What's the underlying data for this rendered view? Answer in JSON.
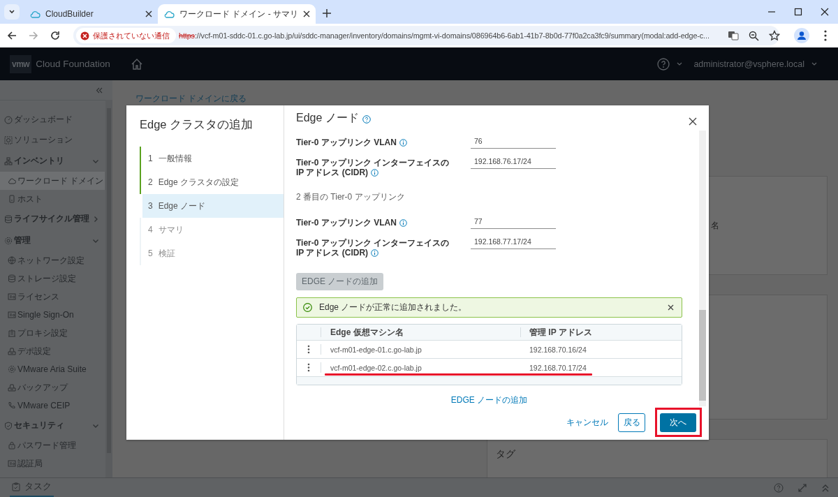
{
  "browser": {
    "tabs": [
      {
        "title": "CloudBuilder",
        "selected": false
      },
      {
        "title": "ワークロード ドメイン - サマリ",
        "selected": true
      }
    ],
    "security_chip": "保護されていない通信",
    "url_scheme": "https",
    "url_rest": "://vcf-m01-sddc-01.c.go-lab.jp/ui/sddc-manager/inventory/domains/mgmt-vi-domains/086964b6-6ab1-41b7-8b0d-77f0a2ca3fc9/summary(modal:add-edge-c..."
  },
  "header": {
    "logo": "vmw",
    "product": "Cloud Foundation",
    "user": "administrator@vsphere.local"
  },
  "sidebar": {
    "items": [
      {
        "label": "ダッシュボード",
        "selected": false
      },
      {
        "label": "ソリューション",
        "selected": false
      },
      {
        "label": "インベントリ",
        "expanded": true,
        "selected": false,
        "children": [
          {
            "label": "ワークロード ドメイン",
            "selected": true
          },
          {
            "label": "ホスト",
            "selected": false
          }
        ]
      },
      {
        "label": "ライフサイクル管理",
        "expanded": false,
        "selected": false
      },
      {
        "label": "管理",
        "expanded": true,
        "selected": false,
        "children": [
          {
            "label": "ネットワーク設定",
            "selected": false
          },
          {
            "label": "ストレージ設定",
            "selected": false
          },
          {
            "label": "ライセンス",
            "selected": false
          },
          {
            "label": "Single Sign-On",
            "selected": false
          },
          {
            "label": "プロキシ設定",
            "selected": false
          },
          {
            "label": "デポ設定",
            "selected": false
          },
          {
            "label": "VMware Aria Suite",
            "selected": false
          },
          {
            "label": "バックアップ",
            "selected": false
          },
          {
            "label": "VMware CEIP",
            "selected": false
          }
        ]
      },
      {
        "label": "セキュリティ",
        "expanded": true,
        "selected": false,
        "children": [
          {
            "label": "パスワード管理",
            "selected": false
          },
          {
            "label": "認証局",
            "selected": false
          }
        ]
      }
    ]
  },
  "main": {
    "breadcrumb": "ワークロード ドメインに戻る",
    "card_fragment": "名",
    "tag_card_title": "タグ"
  },
  "modal": {
    "title": "Edge クラスタの追加",
    "steps": [
      {
        "number": "1",
        "label": "一般情報",
        "completed": true,
        "selected": false
      },
      {
        "number": "2",
        "label": "Edge クラスタの設定",
        "completed": true,
        "selected": false
      },
      {
        "number": "3",
        "label": "Edge ノード",
        "completed": false,
        "selected": true
      },
      {
        "number": "4",
        "label": "サマリ",
        "completed": false,
        "selected": false
      },
      {
        "number": "5",
        "label": "検証",
        "completed": false,
        "selected": false
      }
    ],
    "page_title": "Edge ノード",
    "fields_first": [
      {
        "label_lines": [
          "Tier-0 アップリンク VLAN"
        ],
        "value": "76"
      },
      {
        "label_lines": [
          "Tier-0 アップリンク インターフェイスの",
          "IP アドレス (CIDR)"
        ],
        "value": "192.168.76.17/24"
      }
    ],
    "section_title": "2 番目の Tier-0 アップリンク",
    "fields_second": [
      {
        "label_lines": [
          "Tier-0 アップリンク VLAN"
        ],
        "value": "77"
      },
      {
        "label_lines": [
          "Tier-0 アップリンク インターフェイスの",
          "IP アドレス (CIDR)"
        ],
        "value": "192.168.77.17/24"
      }
    ],
    "add_button": {
      "label": "EDGE ノードの追加",
      "disabled": true
    },
    "alert": {
      "message": "Edge ノードが正常に追加されました。"
    },
    "table": {
      "columns": [
        "Edge 仮想マシン名",
        "管理 IP アドレス"
      ],
      "rows": [
        {
          "name": "vcf-m01-edge-01.c.go-lab.jp",
          "ip": "192.168.70.16/24",
          "highlighted": false
        },
        {
          "name": "vcf-m01-edge-02.c.go-lab.jp",
          "ip": "192.168.70.17/24",
          "highlighted": true
        }
      ]
    },
    "add_link": "EDGE ノードの追加",
    "cancel": "キャンセル",
    "back": "戻る",
    "next": {
      "label": "次へ",
      "highlighted": true
    }
  },
  "taskbar": {
    "label": "タスク"
  }
}
